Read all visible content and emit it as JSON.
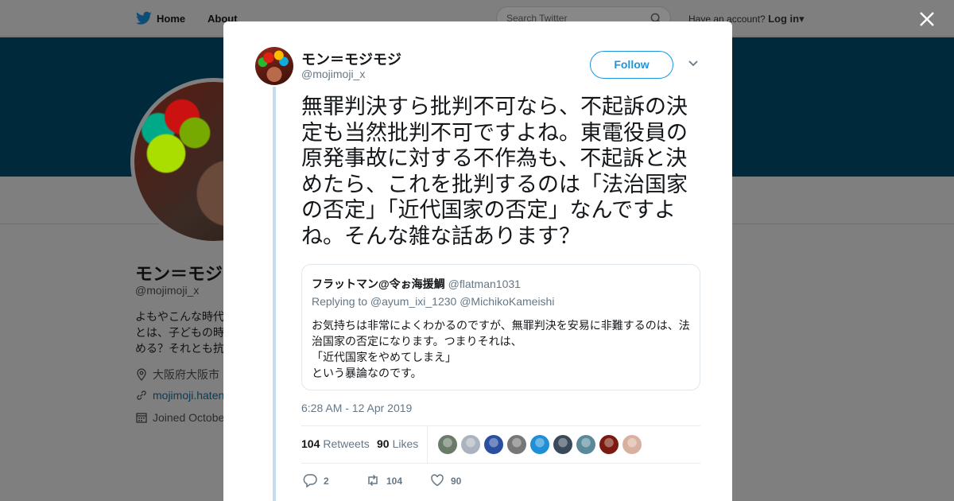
{
  "topbar": {
    "home_label": "Home",
    "about_label": "About",
    "search_placeholder": "Search Twitter",
    "account_prompt": "Have an account?",
    "login_label": "Log in"
  },
  "profile": {
    "name": "モン＝モジ",
    "handle": "@mojimoji_x",
    "bio": "よもやこんな時代\nとは、子どもの時\nめる？それとも抗",
    "location": "大阪府大阪市",
    "website": "mojimoji.haten",
    "joined": "Joined Octobe"
  },
  "tweet": {
    "author_name": "モン＝モジモジ",
    "author_handle": "@mojimoji_x",
    "follow_label": "Follow",
    "text": "無罪判決すら批判不可なら、不起訴の決定も当然批判不可ですよね。東電役員の原発事故に対する不作為も、不起訴と決めたら、これを批判するのは「法治国家の否定」「近代国家の否定」なんですよね。そんな雑な話あります？",
    "timestamp": "6:28 AM - 12 Apr 2019",
    "retweets_count": "104",
    "retweets_label": "Retweets",
    "likes_count": "90",
    "likes_label": "Likes",
    "reply_count": "2",
    "retweet_action_count": "104",
    "like_action_count": "90"
  },
  "quote": {
    "author_name": "フラットマン@令ぉ海援鯛",
    "author_handle": "@flatman1031",
    "replying_to": "Replying to @ayum_ixi_1230 @MichikoKameishi",
    "text": "お気持ちは非常によくわかるのですが、無罪判決を安易に非難するのは、法治国家の否定になります。つまりそれは、\n「近代国家をやめてしまえ」\nという暴論なのです。"
  },
  "likers": [
    {
      "icon": "liker-avatar",
      "color": "#6b7b6a"
    },
    {
      "icon": "liker-avatar",
      "color": "#aab4be"
    },
    {
      "icon": "liker-avatar",
      "color": "#2a4fa0"
    },
    {
      "icon": "liker-avatar",
      "color": "#777777"
    },
    {
      "icon": "liker-avatar",
      "color": "#1f8fd6"
    },
    {
      "icon": "liker-avatar",
      "color": "#3a4a5a"
    },
    {
      "icon": "liker-avatar",
      "color": "#5a8a9a"
    },
    {
      "icon": "liker-avatar",
      "color": "#7a1a10"
    },
    {
      "icon": "liker-avatar",
      "color": "#d8b0a0"
    }
  ],
  "colors": {
    "accent": "#1b95e0",
    "banner": "#00293b",
    "overlay": "#7f7f7f"
  }
}
